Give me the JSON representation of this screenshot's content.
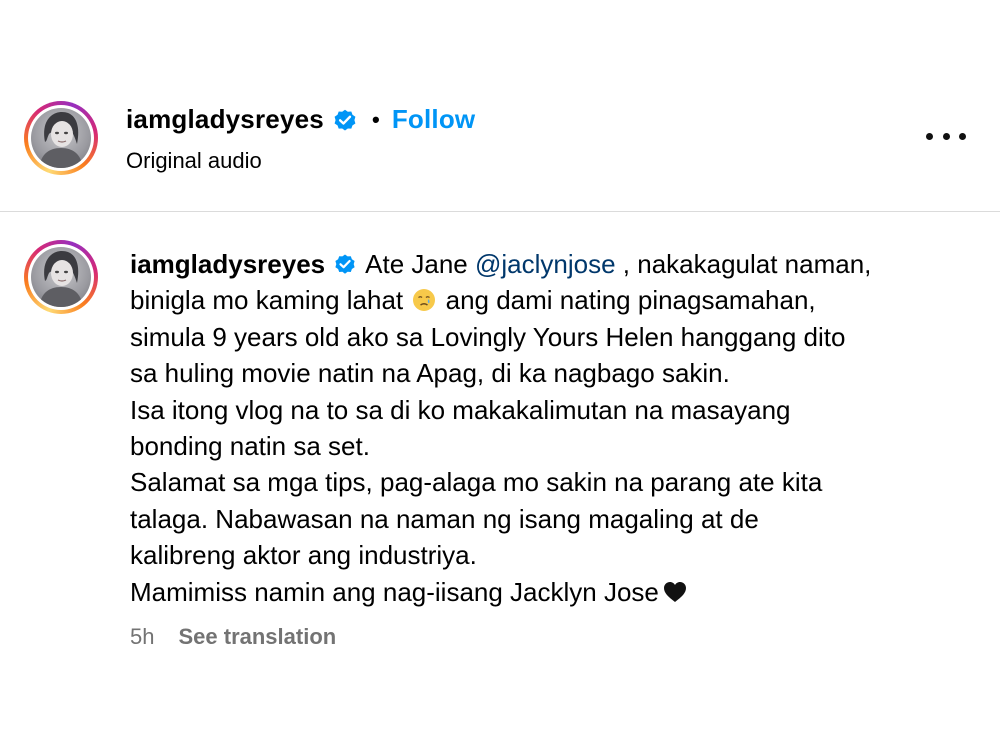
{
  "post_header": {
    "username": "iamgladysreyes",
    "separator": "•",
    "follow_label": "Follow",
    "audio_label": "Original audio"
  },
  "comment": {
    "username": "iamgladysreyes",
    "lines": [
      {
        "text_before": "Ate Jane ",
        "mention": "@jaclynjose",
        "text_after": " , nakakagulat naman,"
      },
      {
        "text_before": "binigla mo kaming lahat",
        "text_after": " ang dami nating pinagsamahan,"
      },
      {
        "text": "simula 9 years old ako sa Lovingly Yours Helen hanggang dito"
      },
      {
        "text": "sa huling movie natin na Apag, di ka nagbago sakin."
      },
      {
        "text": "Isa itong vlog na to sa di ko makakalimutan na masayang"
      },
      {
        "text": "bonding natin sa set."
      },
      {
        "text": "Salamat sa mga tips, pag-alaga mo sakin na parang ate kita"
      },
      {
        "text": "talaga. Nabawasan na naman ng isang magaling at de"
      },
      {
        "text": "kalibreng aktor ang industriya."
      },
      {
        "text": "Mamimiss namin ang nag-iisang Jacklyn Jose"
      }
    ],
    "timestamp": "5h",
    "translation_label": "See translation"
  },
  "icons": {
    "verified": "verified-badge-icon",
    "more": "more-options-icon",
    "crying_emoji": "crying-face-emoji-icon",
    "heart": "heart-icon"
  },
  "colors": {
    "accent": "#0095f6",
    "mention": "#00376b",
    "muted": "#737373",
    "divider": "#dbdbdb"
  }
}
